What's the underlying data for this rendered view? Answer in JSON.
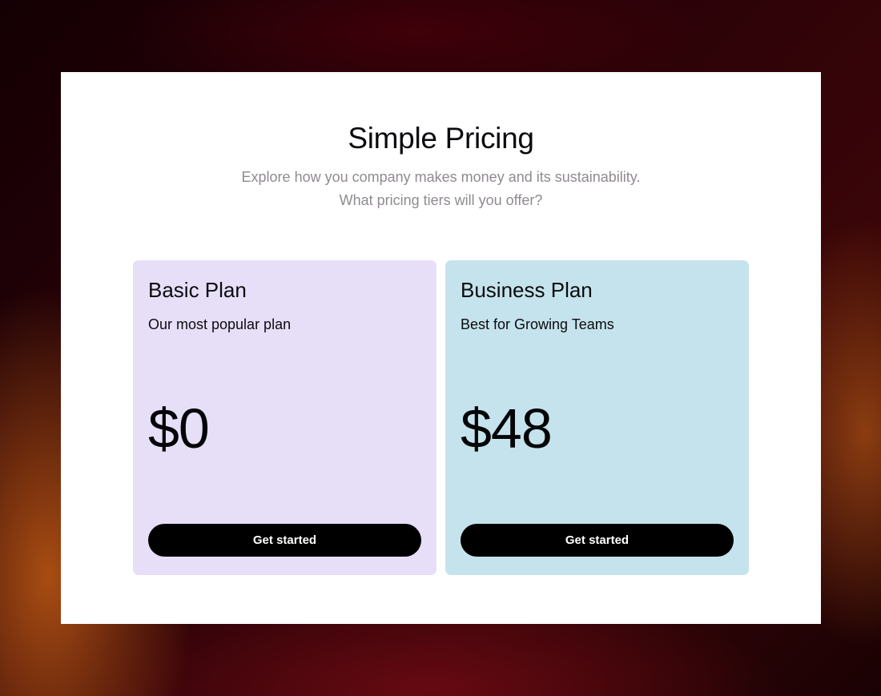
{
  "pricing": {
    "title": "Simple Pricing",
    "subtitle_line1": "Explore how you company makes money and its sustainability.",
    "subtitle_line2": "What pricing tiers will you offer?",
    "plans": [
      {
        "name": "Basic Plan",
        "description": "Our most popular plan",
        "price": "$0",
        "cta_label": "Get started",
        "color": "#e7def8"
      },
      {
        "name": "Business Plan",
        "description": "Best for Growing Teams",
        "price": "$48",
        "cta_label": "Get started",
        "color": "#c5e3ec"
      }
    ]
  },
  "colors": {
    "panel_background": "#ffffff",
    "button_background": "#000000",
    "button_text": "#ffffff",
    "subtitle_text": "#8f8a90"
  }
}
